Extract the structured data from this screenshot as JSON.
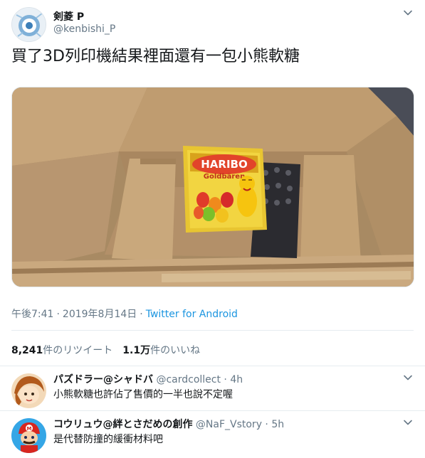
{
  "tweet": {
    "author_name": "剣菱 P",
    "author_handle": "@kenbishi_P",
    "text": "買了3D列印機結果裡面還有一包小熊軟糖",
    "time": "午後7:41",
    "date": "2019年8月14日",
    "source": "Twitter for Android",
    "retweets_count": "8,241",
    "retweets_label": "件のリツイート",
    "likes_count": "1.1万",
    "likes_label": "件のいいね",
    "media": {
      "bag_brand": "HARIBO",
      "bag_product": "Goldbären"
    }
  },
  "replies": [
    {
      "display_name": "パズドラー@シャドバ",
      "handle": "@cardcollect",
      "time": "4h",
      "text": "小熊軟糖也許佔了售價的一半也說不定喔"
    },
    {
      "display_name": "コウリュウ@絆とさだめの創作",
      "handle": "@NaF_Vstory",
      "time": "5h",
      "text": "是代替防撞的緩衝材料吧"
    }
  ],
  "colors": {
    "link": "#1b95e0",
    "secondary_text": "#657786",
    "divider": "#e6ecf0"
  },
  "icons": [
    "chevron-down-icon"
  ]
}
